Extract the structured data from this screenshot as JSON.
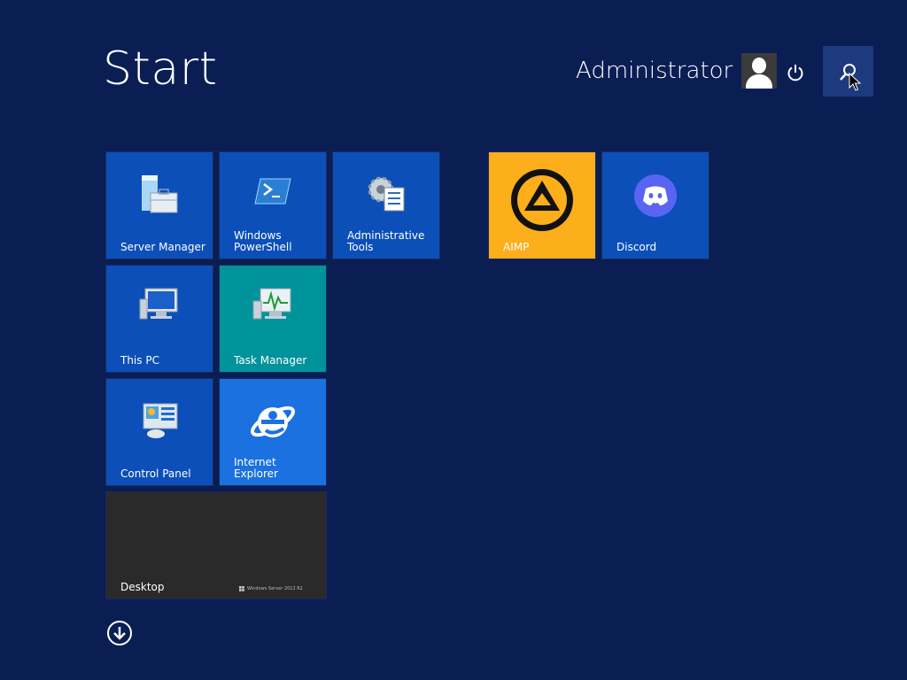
{
  "header": {
    "title": "Start",
    "user_name": "Administrator"
  },
  "icons": {
    "avatar": "user-avatar-icon",
    "power": "power-icon",
    "search": "search-icon",
    "all_apps": "arrow-down-circle-icon"
  },
  "tiles": {
    "server_manager": {
      "label": "Server Manager",
      "color": "#0c4fb8"
    },
    "powershell": {
      "label": "Windows\nPowerShell",
      "color": "#0c4fb8"
    },
    "admin_tools": {
      "label": "Administrative\nTools",
      "color": "#0c4fb8"
    },
    "this_pc": {
      "label": "This PC",
      "color": "#0c4fb8"
    },
    "task_manager": {
      "label": "Task Manager",
      "color": "#00939b"
    },
    "control_panel": {
      "label": "Control Panel",
      "color": "#0c4fb8"
    },
    "internet_explorer": {
      "label": "Internet Explorer",
      "color": "#1a71df"
    },
    "desktop": {
      "label": "Desktop",
      "color": "#2a2a2a",
      "watermark": "Windows Server 2012 R2"
    },
    "aimp": {
      "label": "AIMP",
      "color": "#fdae1b"
    },
    "discord": {
      "label": "Discord",
      "color": "#0c4fb8"
    }
  },
  "colors": {
    "background": "#0b1e54",
    "search_highlight": "#1c3a7d",
    "discord_brand": "#5865f2"
  }
}
